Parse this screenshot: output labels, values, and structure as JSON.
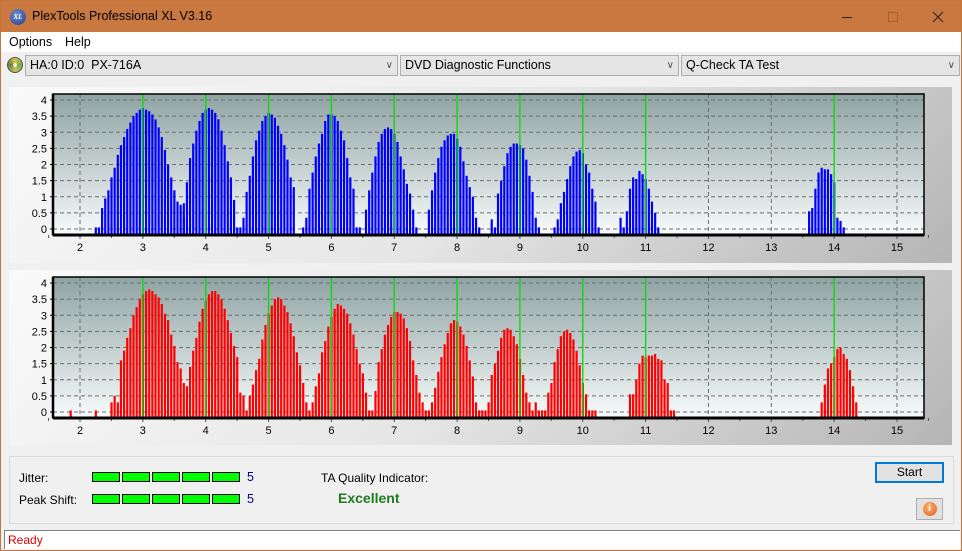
{
  "window": {
    "title": "PlexTools Professional XL V3.16",
    "icon": "plextools-xl-icon",
    "controls": [
      "minimize",
      "maximize",
      "close"
    ]
  },
  "menu": {
    "items": [
      "Options",
      "Help"
    ]
  },
  "toolbar": {
    "drive_select": "HA:0 ID:0  PX-716A",
    "function_select": "DVD Diagnostic Functions",
    "test_select": "Q-Check TA Test"
  },
  "results": {
    "jitter_label": "Jitter:",
    "jitter_value": "5",
    "jitter_level": 5,
    "jitter_max": 5,
    "peak_shift_label": "Peak Shift:",
    "peak_shift_value": "5",
    "peak_shift_level": 5,
    "peak_shift_max": 5,
    "ta_label": "TA Quality Indicator:",
    "ta_value": "Excellent"
  },
  "buttons": {
    "start": "Start",
    "info": "info-icon"
  },
  "status": {
    "text": "Ready"
  },
  "colors": {
    "titlebar": "#c97840",
    "top_bars": "#0000ff",
    "bottom_bars": "#ff0000",
    "reference_lines": "#00ff00",
    "meter": "#00ff00",
    "excellent": "#1f7a1f",
    "status_text": "#e00000"
  },
  "chart_data": [
    {
      "type": "bar",
      "name": "top-histogram",
      "title": "",
      "xlabel": "",
      "ylabel": "",
      "xlim": [
        1.6,
        15.4
      ],
      "ylim": [
        -0.1,
        4.15
      ],
      "x_ticks": [
        2,
        3,
        4,
        5,
        6,
        7,
        8,
        9,
        10,
        11,
        12,
        13,
        14,
        15
      ],
      "y_ticks": [
        0,
        0.5,
        1,
        1.5,
        2,
        2.5,
        3,
        3.5,
        4
      ],
      "y_tick_labels": [
        "0",
        "0.5",
        "1",
        "1.5",
        "2",
        "2.5",
        "3",
        "3.5",
        "4"
      ],
      "grid": true,
      "reference_lines": [
        3,
        4,
        5,
        6,
        7,
        8,
        9,
        10,
        11,
        14
      ],
      "bar_step": 0.05,
      "color": "#0000ff",
      "peaks": [
        {
          "start": 2.25,
          "values": [
            0,
            0,
            0.65,
            0.95,
            1.2,
            1.6,
            1.9,
            2.3,
            2.6,
            2.85,
            3.1,
            3.3,
            3.5,
            3.6,
            3.7,
            3.75,
            3.7,
            3.65,
            3.55,
            3.4,
            3.15,
            2.85,
            2.45,
            2.0,
            1.6,
            1.2,
            0.85,
            0.75,
            0.35
          ]
        },
        {
          "start": 3.65,
          "values": [
            0.8,
            1.45,
            2.2,
            2.65,
            3.05,
            3.35,
            3.6,
            3.7,
            3.75,
            3.7,
            3.6,
            3.4,
            3.05,
            2.6,
            2.1,
            1.6,
            0.9,
            0,
            0
          ]
        },
        {
          "start": 4.6,
          "values": [
            0.35,
            1.15,
            1.65,
            2.25,
            2.75,
            3.05,
            3.35,
            3.5,
            3.6,
            3.55,
            3.45,
            3.2,
            2.95,
            2.6,
            2.15,
            1.6,
            1.3
          ]
        },
        {
          "start": 5.55,
          "values": [
            0,
            0.35,
            1.25,
            1.75,
            2.25,
            2.65,
            2.95,
            3.35,
            3.55,
            3.55,
            3.5,
            3.35,
            3.05,
            2.75,
            2.2,
            1.6,
            1.25,
            0,
            0
          ]
        },
        {
          "start": 6.55,
          "values": [
            0.6,
            1.2,
            1.75,
            2.25,
            2.7,
            2.95,
            3.1,
            3.15,
            3.1,
            2.95,
            2.7,
            2.25,
            1.85,
            1.4,
            1.1,
            0.6,
            0
          ]
        },
        {
          "start": 7.55,
          "values": [
            0.6,
            1.2,
            1.75,
            2.2,
            2.55,
            2.75,
            2.9,
            2.95,
            2.95,
            2.8,
            2.55,
            2.1,
            1.65,
            1.3,
            1.0,
            0.35,
            0
          ]
        },
        {
          "start": 8.55,
          "values": [
            0.3,
            0,
            1.1,
            1.5,
            1.95,
            2.35,
            2.55,
            2.65,
            2.65,
            2.6,
            2.5,
            2.15,
            1.65,
            1.15,
            0.35,
            0
          ]
        },
        {
          "start": 9.55,
          "values": [
            0,
            0.3,
            0.8,
            1.15,
            1.55,
            1.95,
            2.25,
            2.4,
            2.45,
            2.35,
            2.0,
            1.75,
            1.25,
            0.85,
            0
          ]
        },
        {
          "start": 10.6,
          "values": [
            0.35,
            0,
            0.55,
            1.25,
            1.6,
            1.55,
            1.8,
            1.7,
            1.55,
            1.25,
            0.85,
            0.5,
            0
          ]
        },
        {
          "start": 13.6,
          "values": [
            0.55,
            0.65,
            1.25,
            1.75,
            1.9,
            1.85,
            1.85,
            1.7,
            1.45,
            0.35,
            0.25,
            0
          ]
        }
      ]
    },
    {
      "type": "bar",
      "name": "bottom-histogram",
      "title": "",
      "xlabel": "",
      "ylabel": "",
      "xlim": [
        1.6,
        15.4
      ],
      "ylim": [
        -0.1,
        4.15
      ],
      "x_ticks": [
        2,
        3,
        4,
        5,
        6,
        7,
        8,
        9,
        10,
        11,
        12,
        13,
        14,
        15
      ],
      "y_ticks": [
        0,
        0.5,
        1,
        1.5,
        2,
        2.5,
        3,
        3.5,
        4
      ],
      "y_tick_labels": [
        "0",
        "0.5",
        "1",
        "1.5",
        "2",
        "2.5",
        "3",
        "3.5",
        "4"
      ],
      "grid": true,
      "reference_lines": [
        3,
        4,
        5,
        6,
        7,
        8,
        9,
        10,
        11,
        14
      ],
      "bar_step": 0.05,
      "color": "#ff0000",
      "peaks": [
        {
          "start": 1.85,
          "values": [
            0
          ]
        },
        {
          "start": 2.25,
          "values": [
            0
          ]
        },
        {
          "start": 2.5,
          "values": [
            0.3,
            0.5,
            0.3,
            1.6,
            1.9,
            2.3,
            2.6,
            3.0,
            3.25,
            3.5,
            3.65,
            3.75,
            3.8,
            3.75,
            3.65,
            3.55,
            3.35,
            3.05,
            2.85,
            2.4,
            2.05,
            1.55,
            1.35,
            0.9,
            0.8,
            1.4,
            1.9,
            2.3,
            2.8,
            3.2,
            3.45,
            3.65,
            3.75,
            3.75,
            3.65,
            3.5,
            3.2,
            2.85,
            2.45,
            2.05,
            1.7,
            0.6,
            0.5,
            0,
            0.5,
            0.85,
            1.3,
            1.65,
            2.25,
            2.7,
            3.05,
            3.3,
            3.5,
            3.55,
            3.5,
            3.3,
            3.1,
            2.75,
            2.35,
            1.85,
            1.45,
            0.9,
            0.3,
            0,
            0.3,
            0.8,
            1.2,
            1.85,
            2.2,
            2.65,
            2.95,
            3.2,
            3.35,
            3.3,
            3.2,
            3.05,
            2.75,
            2.4,
            1.95,
            1.5,
            1.2,
            0.6,
            0,
            0,
            0.65,
            1.55,
            1.95,
            2.4,
            2.7,
            2.95,
            3.1,
            3.1,
            3.05,
            2.9,
            2.6,
            2.2,
            1.6,
            1.15,
            0.6,
            0.3,
            0,
            0,
            0.3,
            0.75,
            1.25,
            1.7,
            2.1,
            2.45,
            2.75,
            2.85,
            2.8,
            2.65,
            2.4,
            2.05,
            1.6,
            1.1,
            0.3,
            0,
            0,
            0,
            0.3,
            1.15,
            1.5,
            1.9,
            2.3,
            2.55,
            2.6,
            2.55,
            2.35,
            2.1,
            1.65,
            1.15,
            0.6,
            0.3,
            0,
            0.3,
            0,
            0,
            0,
            0.6,
            0.9,
            1.55,
            1.95,
            2.35,
            2.5,
            2.55,
            2.45,
            2.25,
            1.9,
            1.45,
            0.9,
            0.55,
            0.05,
            0,
            0.05
          ]
        },
        {
          "start": 10.75,
          "values": [
            0.55,
            0.55,
            1.0,
            1.5,
            1.75,
            1.7,
            1.75,
            1.75,
            1.8,
            1.65,
            1.6,
            1.0,
            0.9,
            0.05,
            0.05
          ]
        },
        {
          "start": 13.8,
          "values": [
            0.3,
            0.85,
            1.35,
            1.5,
            1.7,
            1.95,
            2.0,
            1.8,
            1.65,
            1.3,
            0.8,
            0.3
          ]
        }
      ]
    }
  ]
}
